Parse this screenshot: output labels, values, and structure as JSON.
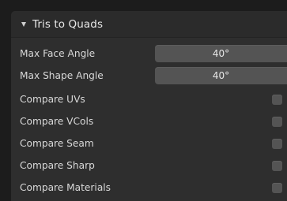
{
  "panel": {
    "title": "Tris to Quads",
    "expanded": true
  },
  "fields": [
    {
      "label": "Max Face Angle",
      "value": "40°"
    },
    {
      "label": "Max Shape Angle",
      "value": "40°"
    }
  ],
  "options": [
    {
      "label": "Compare UVs",
      "checked": false
    },
    {
      "label": "Compare VCols",
      "checked": false
    },
    {
      "label": "Compare Seam",
      "checked": false
    },
    {
      "label": "Compare Sharp",
      "checked": false
    },
    {
      "label": "Compare Materials",
      "checked": false
    }
  ],
  "colors": {
    "panel_bg": "#2e2e2e",
    "field_bg": "#545454",
    "text": "#d8d8d8"
  }
}
